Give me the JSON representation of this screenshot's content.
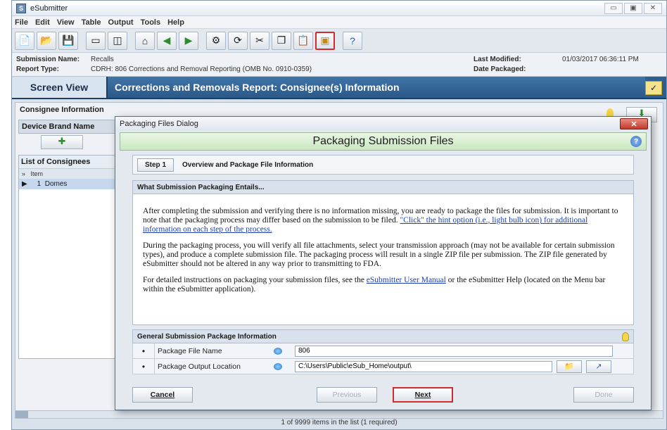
{
  "app": {
    "title": "eSubmitter",
    "icon_letter": "S"
  },
  "window_controls": [
    "▭",
    "▣",
    "✕"
  ],
  "menu": [
    "File",
    "Edit",
    "View",
    "Table",
    "Output",
    "Tools",
    "Help"
  ],
  "toolbar_icons": [
    "new-document-icon",
    "open-folder-icon",
    "save-icon",
    "layout-icon",
    "split-view-icon",
    "home-icon",
    "back-arrow-icon",
    "forward-arrow-icon",
    "settings-icon",
    "refresh-icon",
    "scissors-icon",
    "copy-icon",
    "paste-icon",
    "package-icon",
    "help-icon"
  ],
  "submission": {
    "name_label": "Submission Name:",
    "name_value": "Recalls",
    "type_label": "Report Type:",
    "type_value": "CDRH: 806 Corrections and Removal Reporting (OMB No. 0910-0359)",
    "modified_label": "Last Modified:",
    "modified_value": "01/03/2017 06:36:11 PM",
    "packaged_label": "Date Packaged:"
  },
  "nav": {
    "screen_view": "Screen View",
    "page_title": "Corrections and Removals Report: Consignee(s) Information"
  },
  "background": {
    "section": "Consignee Information",
    "device_brand": "Device Brand Name",
    "list_title": "List of Consignees",
    "col_item": "Item",
    "row_item": "1",
    "row_value": "Domes",
    "status": "1 of 9999 items in the list (1 required)"
  },
  "dialog": {
    "title": "Packaging Files Dialog",
    "close": "✕",
    "header": "Packaging Submission Files",
    "step_label": "Step 1",
    "step_title": "Overview and Package File Information",
    "section_title": "What Submission Packaging Entails...",
    "p1_a": "After completing the submission and verifying there is no information missing, you are ready to package the files for submission. It is important to note that the packaging process may differ based on the submission to be filed. ",
    "p1_link": "\"Click\" the hint option (i.e., light bulb icon) for additional information on each step of the process.",
    "p2": "During the packaging process, you will verify all file attachments, select your transmission approach (may not be available for certain submission types), and produce a complete submission file. The packaging process will result in a single ZIP file per submission. The ZIP file generated by eSubmitter should not be altered in any way prior to transmitting to FDA.",
    "p3_a": "For detailed instructions on packaging your submission files, see the ",
    "p3_link": "eSubmitter User Manual",
    "p3_b": " or the eSubmitter Help (located on the Menu bar within the eSubmitter application).",
    "general_title": "General Submission Package Information",
    "field1_label": "Package File Name",
    "field1_value": "806",
    "field2_label": "Package Output Location",
    "field2_value": "C:\\Users\\Public\\eSub_Home\\output\\",
    "cancel": "Cancel",
    "previous": "Previous",
    "next": "Next",
    "done": "Done"
  }
}
